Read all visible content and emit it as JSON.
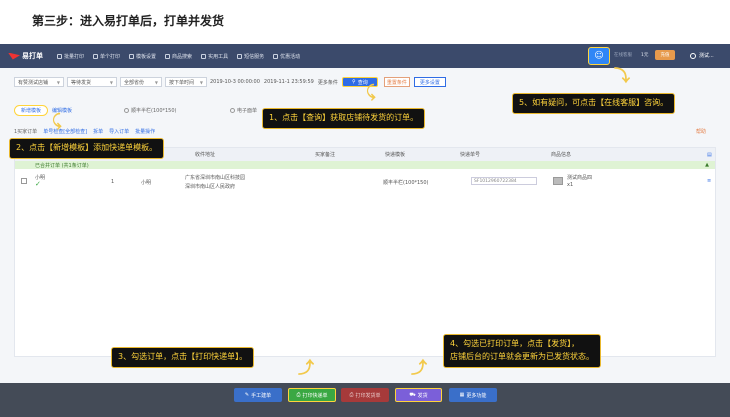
{
  "heading": "第三步：进入易打单后，打单并发货",
  "app": {
    "logo": "易打单",
    "nav": [
      "批量打印",
      "单个打印",
      "模板设置",
      "商品搜索",
      "实用工具",
      "短信服务",
      "优惠活动"
    ],
    "customer_service_icon": "qq-icon",
    "top_right_text": "在线客服",
    "balance": "1元",
    "recharge": "充值",
    "user": "测试..."
  },
  "filters": {
    "shop": "有赞测试店铺",
    "status": "等待发货",
    "province": "全部省份",
    "time_type": "按下单时间",
    "date_from": "2019-10-3 00:00:00",
    "date_to": "2019-11-1 23:59:59",
    "more": "更多条件",
    "query": "查询",
    "reset": "重置条件",
    "more_settings": "更多设置"
  },
  "templates": {
    "add": "新增模板",
    "edit": "编辑模板",
    "options": [
      "顺丰半栏(100*150)",
      "电子面单"
    ]
  },
  "link_row": [
    "1买家订单",
    "单号检查[全部检查]",
    "拆单",
    "导入订单",
    "批量操作"
  ],
  "orange_link": "帮助",
  "table": {
    "headers": [
      "收件地址",
      "买家备注",
      "快递模板",
      "快递单号",
      "商品信息"
    ],
    "group": "已合并订单 (共1条订单)",
    "row": {
      "name": "小明",
      "qty": "1",
      "buyer": "小明",
      "address_line1": "广东省深圳市南山区科技园",
      "address_line2": "深圳市南山区人民政府",
      "template": "顺丰半栏(100*150)",
      "waybill": "SF1012960722384",
      "product": "测试商品四",
      "product_qty": "x1"
    }
  },
  "bottom_buttons": [
    "手工建单",
    "打印快递单",
    "打印发货单",
    "发货",
    "更多功能"
  ],
  "callouts": {
    "c1": "1、点击【查询】获取店铺待发货的订单。",
    "c2": "2、点击【新增模板】添加快递单模板。",
    "c3": "3、勾选订单，点击【打印快递单】。",
    "c4a": "4、勾选已打印订单，点击【发货】，",
    "c4b": "店铺后台的订单就会更新为已发货状态。",
    "c5": "5、如有疑问，可点击【在线客服】咨询。"
  }
}
